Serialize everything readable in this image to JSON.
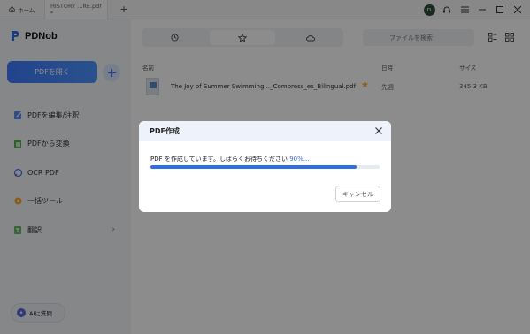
{
  "titlebar": {
    "home_tab_label": "ホーム",
    "doc_tab_label": "HISTORY ...RE.pdf *",
    "avatar_letter": "n"
  },
  "sidebar": {
    "brand_name": "PDNob",
    "open_button": "PDFを開く",
    "items": [
      {
        "label": "PDFを編集/注釈",
        "icon": "edit-doc-icon"
      },
      {
        "label": "PDFから変換",
        "icon": "convert-icon"
      },
      {
        "label": "OCR PDF",
        "icon": "ocr-icon"
      },
      {
        "label": "一括ツール",
        "icon": "batch-tools-icon"
      },
      {
        "label": "翻訳",
        "icon": "translate-icon"
      }
    ],
    "ai_button": "AIに質問"
  },
  "main": {
    "search_placeholder": "ファイルを検索",
    "columns": {
      "name": "名前",
      "date": "日時",
      "size": "サイズ"
    },
    "files": [
      {
        "name": "The Joy of Summer Swimming..._Compress_es_Bilingual.pdf",
        "date": "先週",
        "size": "345.3 KB",
        "starred": true
      }
    ]
  },
  "dialog": {
    "title": "PDF作成",
    "message": "PDF を作成しています。しばらくお待ちください",
    "percent_text": "90%...",
    "progress": 0.9,
    "cancel_label": "キャンセル"
  },
  "colors": {
    "accent": "#2f6fe4",
    "star": "#f5a623"
  }
}
